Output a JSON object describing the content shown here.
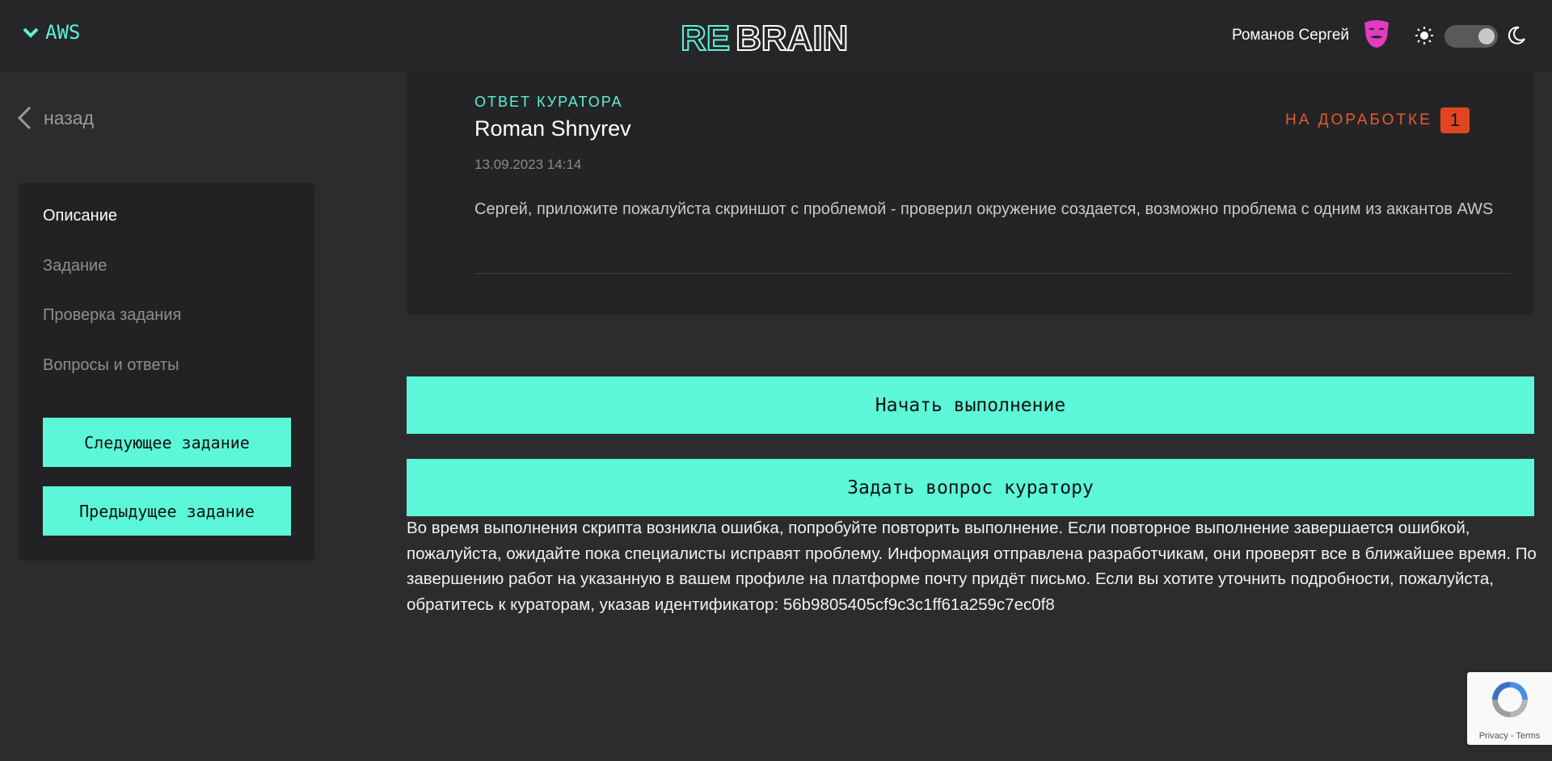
{
  "header": {
    "course_label": "AWS",
    "user_name": "Романов Сергей"
  },
  "sidebar": {
    "back_label": "назад",
    "nav": [
      "Описание",
      "Задание",
      "Проверка задания",
      "Вопросы и ответы"
    ],
    "next_label": "Следующее задание",
    "prev_label": "Предыдущее задание"
  },
  "curator": {
    "label": "ОТВЕТ КУРАТОРА",
    "name": "Roman Shnyrev",
    "date": "13.09.2023 14:14",
    "status": "НА ДОРАБОТКЕ",
    "status_count": "1",
    "text": "Сергей, приложите пожалуйста скриншот с проблемой - проверил окружение создается, возможно проблема с одним из аккантов AWS"
  },
  "actions": {
    "start_label": "Начать выполнение",
    "ask_label": "Задать вопрос куратору"
  },
  "error_message": "Во время выполнения скрипта возникла ошибка, попробуйте повторить выполнение. Если повторное выполнение завершается ошибкой, пожалуйста, ожидайте пока специалисты исправят проблему. Информация отправлена разработчикам, они проверят все в ближайшее время. По завершению работ на указанную в вашем профиле на платформе почту придёт письмо. Если вы хотите уточнить подробности, пожалуйста, обратитесь к кураторам, указав идентификатор: 56b9805405cf9c3c1ff61a259c7ec0f8",
  "recaptcha": {
    "links": "Privacy - Terms"
  },
  "logo": {
    "text_re": "RE",
    "text_brain": "BRAIN"
  },
  "colors": {
    "accent": "#5cf7d8",
    "status": "#e2461f",
    "background": "#2c2c2e"
  },
  "icons": {
    "course_toggle": "chevron-down-icon",
    "back": "chevron-left-icon",
    "avatar": "anonymous-mask-icon",
    "light_theme": "sun-icon",
    "dark_theme": "moon-icon"
  },
  "theme_toggle": {
    "dark_mode_on": true
  }
}
